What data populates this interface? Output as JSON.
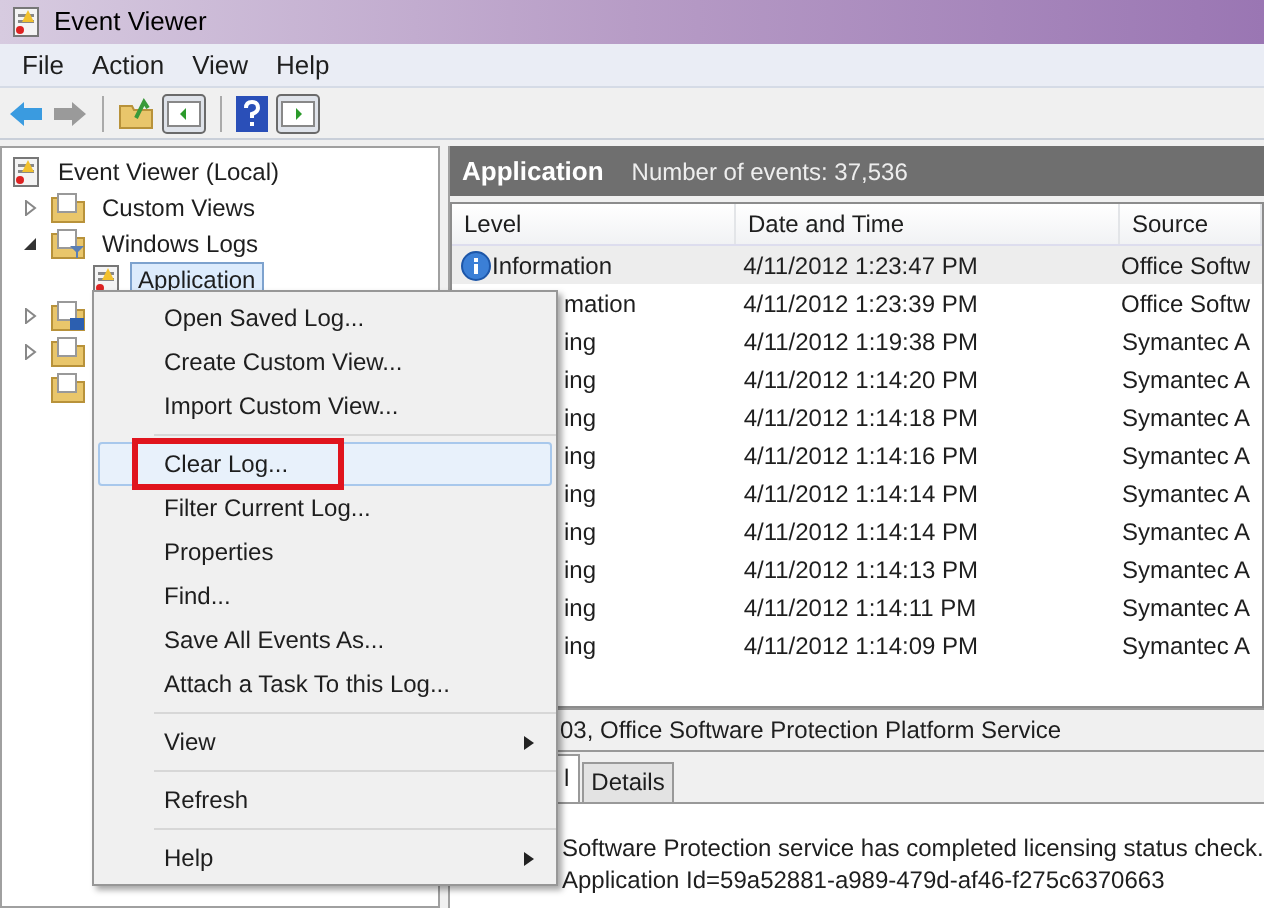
{
  "window": {
    "title": "Event Viewer"
  },
  "menubar": [
    "File",
    "Action",
    "View",
    "Help"
  ],
  "tree": [
    {
      "kind": "log",
      "label": "Event Viewer (Local)",
      "children": [
        {
          "kind": "folder",
          "label": "Custom Views",
          "expanded": false
        },
        {
          "kind": "folder",
          "label": "Windows Logs",
          "expanded": true,
          "children": [
            {
              "kind": "log",
              "label": "Application",
              "selected": true
            }
          ]
        },
        {
          "kind": "folder",
          "expanded": false
        },
        {
          "kind": "folder",
          "expanded": false
        },
        {
          "kind": "folder"
        }
      ]
    }
  ],
  "panel": {
    "title": "Application",
    "count": "Number of events: 37,536"
  },
  "table": {
    "columns": [
      "Level",
      "Date and Time",
      "Source"
    ],
    "rows": [
      {
        "level": "Information",
        "icon": true,
        "date": "4/11/2012 1:23:47 PM",
        "source": "Office Softw",
        "selected": true
      },
      {
        "level": "mation",
        "date": "4/11/2012 1:23:39 PM",
        "source": "Office Softw",
        "selected": false
      },
      {
        "level": "ing",
        "date": "4/11/2012 1:19:38 PM",
        "source": "Symantec A",
        "selected": false
      },
      {
        "level": "ing",
        "date": "4/11/2012 1:14:20 PM",
        "source": "Symantec A",
        "selected": false
      },
      {
        "level": "ing",
        "date": "4/11/2012 1:14:18 PM",
        "source": "Symantec A",
        "selected": false
      },
      {
        "level": "ing",
        "date": "4/11/2012 1:14:16 PM",
        "source": "Symantec A",
        "selected": false
      },
      {
        "level": "ing",
        "date": "4/11/2012 1:14:14 PM",
        "source": "Symantec A",
        "selected": false
      },
      {
        "level": "ing",
        "date": "4/11/2012 1:14:14 PM",
        "source": "Symantec A",
        "selected": false
      },
      {
        "level": "ing",
        "date": "4/11/2012 1:14:13 PM",
        "source": "Symantec A",
        "selected": false
      },
      {
        "level": "ing",
        "date": "4/11/2012 1:14:11 PM",
        "source": "Symantec A",
        "selected": false
      },
      {
        "level": "ing",
        "date": "4/11/2012 1:14:09 PM",
        "source": "Symantec A",
        "selected": false
      }
    ]
  },
  "details": {
    "header": "03, Office Software Protection Platform Service",
    "tabs": [
      {
        "label": "l",
        "selected": true
      },
      {
        "label": "Details",
        "selected": false
      }
    ],
    "lines": [
      "Software Protection service has completed licensing status check.",
      "Application Id=59a52881-a989-479d-af46-f275c6370663"
    ]
  },
  "context_menu": [
    {
      "kind": "item",
      "label": "Open Saved Log...",
      "selected": false
    },
    {
      "kind": "item",
      "label": "Create Custom View...",
      "selected": false
    },
    {
      "kind": "item",
      "label": "Import Custom View...",
      "selected": false
    },
    {
      "kind": "separator"
    },
    {
      "kind": "item",
      "label": "Clear Log...",
      "selected": true,
      "annotated": true
    },
    {
      "kind": "item",
      "label": "Filter Current Log...",
      "selected": false
    },
    {
      "kind": "item",
      "label": "Properties",
      "selected": false
    },
    {
      "kind": "item",
      "label": "Find...",
      "selected": false
    },
    {
      "kind": "item",
      "label": "Save All Events As...",
      "selected": false
    },
    {
      "kind": "item",
      "label": "Attach a Task To this Log...",
      "selected": false
    },
    {
      "kind": "separator"
    },
    {
      "kind": "item",
      "label": "View",
      "selected": false,
      "submenu": true
    },
    {
      "kind": "separator"
    },
    {
      "kind": "item",
      "label": "Refresh",
      "selected": false
    },
    {
      "kind": "separator"
    },
    {
      "kind": "item",
      "label": "Help",
      "selected": false,
      "submenu": true
    }
  ]
}
